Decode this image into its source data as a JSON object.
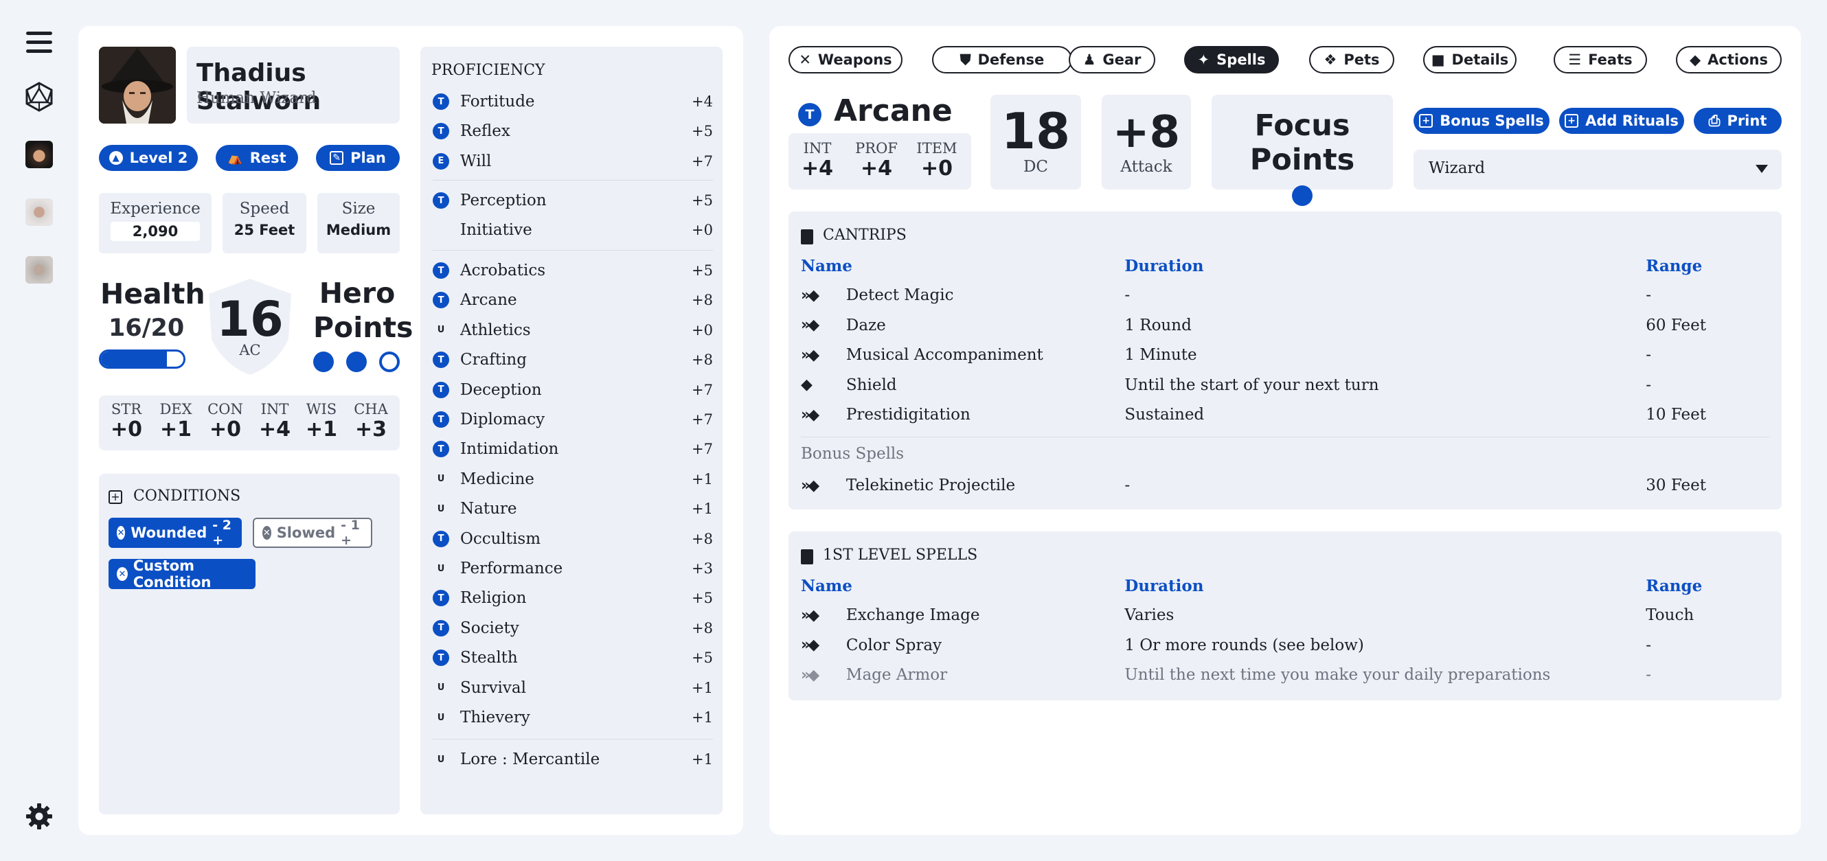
{
  "colors": {
    "accent": "#0b4fc4",
    "dark": "#1c1f26",
    "panel": "#ffffff",
    "card": "#edf0f6",
    "background": "#f1f4f9"
  },
  "rail": {
    "icons": [
      "menu-icon",
      "d20-icon",
      "avatar-1",
      "avatar-2",
      "avatar-3",
      "settings-icon"
    ]
  },
  "character": {
    "name": "Thadius Stalworn",
    "subtitle": "Human Wizard"
  },
  "actions": {
    "level": "Level 2",
    "rest": "Rest",
    "plan": "Plan"
  },
  "stats": {
    "experience_label": "Experience",
    "experience": "2,090",
    "speed_label": "Speed",
    "speed": "25 Feet",
    "size_label": "Size",
    "size": "Medium"
  },
  "health": {
    "label": "Health",
    "value": "16/20",
    "fraction": 0.8
  },
  "ac": {
    "value": "16",
    "label": "AC"
  },
  "hero_points": {
    "label_1": "Hero",
    "label_2": "Points",
    "filled": 2,
    "total": 3
  },
  "abilities": [
    {
      "label": "STR",
      "value": "+0"
    },
    {
      "label": "DEX",
      "value": "+1"
    },
    {
      "label": "CON",
      "value": "+0"
    },
    {
      "label": "INT",
      "value": "+4"
    },
    {
      "label": "WIS",
      "value": "+1"
    },
    {
      "label": "CHA",
      "value": "+3"
    }
  ],
  "conditions": {
    "title": "CONDITIONS",
    "wounded": "Wounded",
    "wounded_value": "- 2 +",
    "slowed": "Slowed",
    "slowed_value": "- 1 +",
    "custom": "Custom Condition"
  },
  "proficiency": {
    "title": "PROFICIENCY",
    "saves": [
      {
        "rank": "T",
        "name": "Fortitude",
        "mod": "+4"
      },
      {
        "rank": "T",
        "name": "Reflex",
        "mod": "+5"
      },
      {
        "rank": "E",
        "name": "Will",
        "mod": "+7"
      }
    ],
    "perception": [
      {
        "rank": "T",
        "name": "Perception",
        "mod": "+5"
      },
      {
        "rank": "",
        "name": "Initiative",
        "mod": "+0"
      }
    ],
    "skills": [
      {
        "rank": "T",
        "name": "Acrobatics",
        "mod": "+5"
      },
      {
        "rank": "T",
        "name": "Arcane",
        "mod": "+8"
      },
      {
        "rank": "U",
        "name": "Athletics",
        "mod": "+0"
      },
      {
        "rank": "T",
        "name": "Crafting",
        "mod": "+8"
      },
      {
        "rank": "T",
        "name": "Deception",
        "mod": "+7"
      },
      {
        "rank": "T",
        "name": "Diplomacy",
        "mod": "+7"
      },
      {
        "rank": "T",
        "name": "Intimidation",
        "mod": "+7"
      },
      {
        "rank": "U",
        "name": "Medicine",
        "mod": "+1"
      },
      {
        "rank": "U",
        "name": "Nature",
        "mod": "+1"
      },
      {
        "rank": "T",
        "name": "Occultism",
        "mod": "+8"
      },
      {
        "rank": "U",
        "name": "Performance",
        "mod": "+3"
      },
      {
        "rank": "T",
        "name": "Religion",
        "mod": "+5"
      },
      {
        "rank": "T",
        "name": "Society",
        "mod": "+8"
      },
      {
        "rank": "T",
        "name": "Stealth",
        "mod": "+5"
      },
      {
        "rank": "U",
        "name": "Survival",
        "mod": "+1"
      },
      {
        "rank": "U",
        "name": "Thievery",
        "mod": "+1"
      }
    ],
    "lore": [
      {
        "rank": "U",
        "name": "Lore : Mercantile",
        "mod": "+1"
      }
    ]
  },
  "tabs": [
    {
      "label": "Weapons",
      "icon": "crossed-swords-icon",
      "active": false
    },
    {
      "label": "Defense",
      "icon": "shield-icon",
      "active": false
    },
    {
      "label": "Gear",
      "icon": "bag-icon",
      "active": false
    },
    {
      "label": "Spells",
      "icon": "sparkles-icon",
      "active": true
    },
    {
      "label": "Pets",
      "icon": "paw-icon",
      "active": false
    },
    {
      "label": "Details",
      "icon": "note-icon",
      "active": false
    },
    {
      "label": "Feats",
      "icon": "list-icon",
      "active": false
    },
    {
      "label": "Actions",
      "icon": "action-diamond-icon",
      "active": false
    }
  ],
  "spellcasting": {
    "rank": "T",
    "tradition": "Arcane",
    "int_label": "INT",
    "int": "+4",
    "prof_label": "PROF",
    "prof": "+4",
    "item_label": "ITEM",
    "item": "+0",
    "dc": "18",
    "dc_label": "DC",
    "attack": "+8",
    "attack_label": "Attack",
    "focus_label": "Focus Points",
    "focus_points": 1
  },
  "spell_actions": {
    "bonus": "Bonus Spells",
    "rituals": "Add Rituals",
    "print": "Print"
  },
  "class_select": {
    "value": "Wizard"
  },
  "cantrips": {
    "title": "CANTRIPS",
    "columns": [
      "Name",
      "Duration",
      "Range"
    ],
    "rows": [
      {
        "actions": 2,
        "name": "Detect Magic",
        "duration": "-",
        "range": "-"
      },
      {
        "actions": 2,
        "name": "Daze",
        "duration": "1 Round",
        "range": "60 Feet"
      },
      {
        "actions": 2,
        "name": "Musical Accompaniment",
        "duration": "1 Minute",
        "range": "-"
      },
      {
        "actions": 1,
        "name": "Shield",
        "duration": "Until the start of your next turn",
        "range": "-"
      },
      {
        "actions": 2,
        "name": "Prestidigitation",
        "duration": "Sustained",
        "range": "10 Feet"
      }
    ],
    "bonus_label": "Bonus Spells",
    "bonus_rows": [
      {
        "actions": 2,
        "name": "Telekinetic Projectile",
        "duration": "-",
        "range": "30 Feet"
      }
    ]
  },
  "first_level": {
    "title": "1ST LEVEL SPELLS",
    "columns": [
      "Name",
      "Duration",
      "Range"
    ],
    "rows": [
      {
        "actions": 2,
        "name": "Exchange Image",
        "duration": "Varies",
        "range": "Touch",
        "muted": false
      },
      {
        "actions": 2,
        "name": "Color Spray",
        "duration": "1 Or more rounds (see below)",
        "range": "-",
        "muted": false
      },
      {
        "actions": 2,
        "name": "Mage Armor",
        "duration": "Until the next time you make your daily preparations",
        "range": "-",
        "muted": true
      }
    ]
  }
}
